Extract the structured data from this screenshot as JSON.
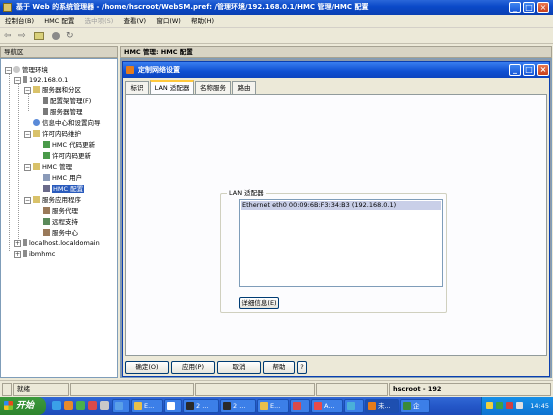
{
  "window": {
    "title": "基于 Web 的系统管理器 - /home/hscroot/WebSM.pref: /管理环境/192.168.0.1/HMC 管理/HMC 配置"
  },
  "menubar": {
    "items": [
      "控制台(B)",
      "HMC 配置",
      "选中项(S)",
      "查看(V)",
      "窗口(W)",
      "帮助(H)"
    ]
  },
  "toolbar": {
    "icons": [
      "back-arrow-icon",
      "forward-arrow-icon",
      "folder-icon",
      "stop-icon",
      "refresh-icon"
    ]
  },
  "nav": {
    "header": "导航区",
    "tree": [
      {
        "label": "管理环境",
        "level": 0,
        "expanded": true,
        "icon": "globe-icon"
      },
      {
        "label": "192.168.0.1",
        "level": 1,
        "expanded": true,
        "icon": "server-icon"
      },
      {
        "label": "服务器和分区",
        "level": 2,
        "expanded": true,
        "icon": "folder-icon"
      },
      {
        "label": "配置架管理(F)",
        "level": 3,
        "icon": "frame-icon"
      },
      {
        "label": "服务器管理",
        "level": 3,
        "icon": "server-icon"
      },
      {
        "label": "信息中心和设置向导",
        "level": 2,
        "icon": "info-icon"
      },
      {
        "label": "许可内码维护",
        "level": 2,
        "expanded": true,
        "icon": "folder-icon"
      },
      {
        "label": "HMC 代码更新",
        "level": 3,
        "icon": "update-icon"
      },
      {
        "label": "许可内码更新",
        "level": 3,
        "icon": "update-icon"
      },
      {
        "label": "HMC 管理",
        "level": 2,
        "expanded": true,
        "icon": "folder-icon"
      },
      {
        "label": "HMC 用户",
        "level": 3,
        "icon": "user-icon"
      },
      {
        "label": "HMC 配置",
        "level": 3,
        "icon": "config-icon",
        "selected": true
      },
      {
        "label": "服务应用程序",
        "level": 2,
        "expanded": true,
        "icon": "folder-icon"
      },
      {
        "label": "服务代理",
        "level": 3,
        "icon": "wrench-icon"
      },
      {
        "label": "远程支持",
        "level": 3,
        "icon": "remote-icon"
      },
      {
        "label": "服务中心",
        "level": 3,
        "icon": "wrench-icon"
      },
      {
        "label": "localhost.localdomain",
        "level": 0,
        "collapsed": true,
        "icon": "server-icon"
      },
      {
        "label": "ibmhmc",
        "level": 0,
        "collapsed": true,
        "icon": "server-icon"
      }
    ]
  },
  "right_pane": {
    "header": "HMC 管理: HMC 配置"
  },
  "dialog": {
    "title": "定制网络设置",
    "tabs": [
      "标识",
      "LAN 适配器",
      "名称服务",
      "路由"
    ],
    "active_tab": "LAN 适配器",
    "group_label": "LAN 适配器",
    "list_items": [
      "Ethernet eth0  00:09:6B:F3:34:B3 (192.168.0.1)"
    ],
    "details_button": "详细信息(E)",
    "buttons": {
      "ok": "确定(O)",
      "apply": "应用(P)",
      "cancel": "取消",
      "help": "帮助",
      "help_q": "?"
    }
  },
  "statusbar": {
    "ready": "就绪",
    "user": "hscroot - 192"
  },
  "taskbar": {
    "start_label": "开始",
    "tasks": [
      "",
      "E...",
      "",
      "2 ...",
      "2 ...",
      "E...",
      "",
      "A...",
      "",
      "未...",
      "企"
    ],
    "clock": "14:45"
  },
  "colors": {
    "title_blue": "#0a49c8",
    "selection": "#2a5bbd",
    "taskbar_blue": "#2457c8",
    "start_green": "#2d842d"
  }
}
